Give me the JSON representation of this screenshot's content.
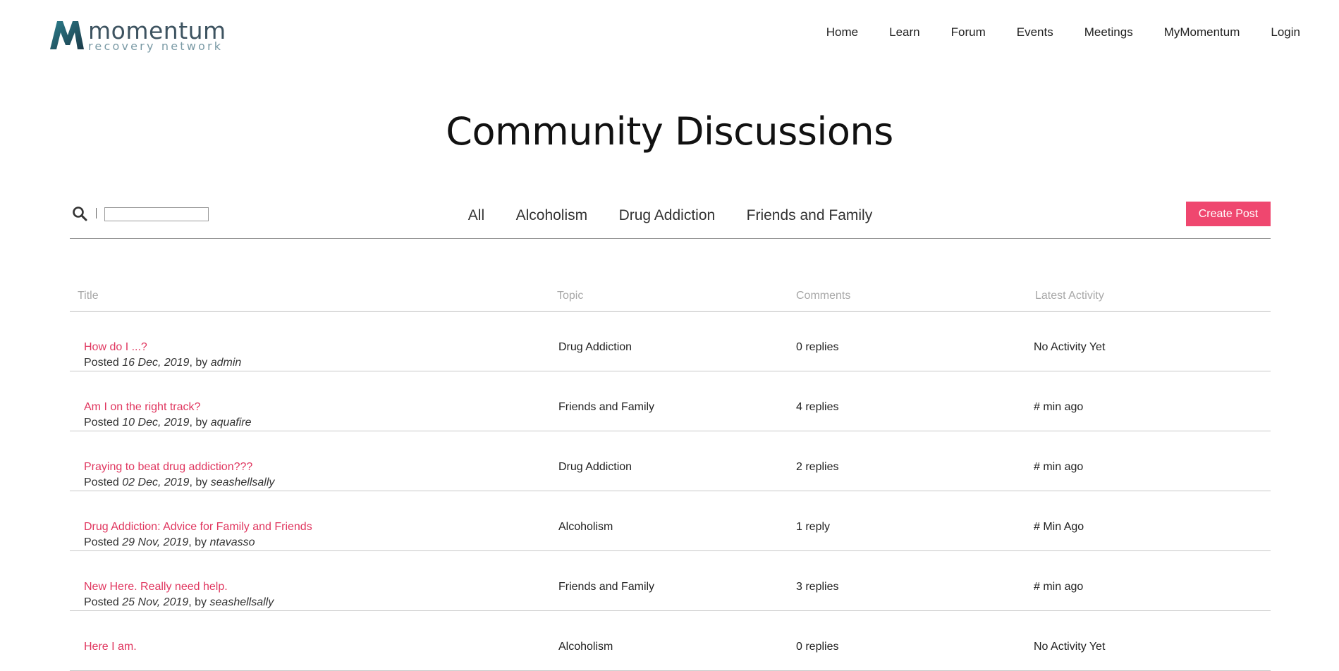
{
  "brand": {
    "name": "momentum",
    "tagline": "recovery network"
  },
  "nav": [
    "Home",
    "Learn",
    "Forum",
    "Events",
    "Meetings",
    "MyMomentum",
    "Login"
  ],
  "page_title": "Community Discussions",
  "search": {
    "placeholder": "",
    "value": ""
  },
  "filters": [
    "All",
    "Alcoholism",
    "Drug Addiction",
    "Friends and Family"
  ],
  "create_post_label": "Create Post",
  "columns": {
    "title": "Title",
    "topic": "Topic",
    "comments": "Comments",
    "activity": "Latest Activity"
  },
  "posted_label": "Posted",
  "by_label": ", by",
  "rows": [
    {
      "title": "How do I ...?",
      "date": "16 Dec, 2019",
      "author": "admin",
      "topic": "Drug Addiction",
      "comments": "0 replies",
      "activity": "No Activity Yet"
    },
    {
      "title": "Am I on the right track?",
      "date": "10 Dec, 2019",
      "author": "aquafire",
      "topic": "Friends and Family",
      "comments": "4 replies",
      "activity": "# min ago"
    },
    {
      "title": "Praying to beat drug addiction???",
      "date": "02 Dec, 2019",
      "author": "seashellsally",
      "topic": "Drug Addiction",
      "comments": "2 replies",
      "activity": "# min ago"
    },
    {
      "title": "Drug Addiction: Advice for Family and Friends",
      "date": "29 Nov, 2019",
      "author": "ntavasso",
      "topic": "Alcoholism",
      "comments": "1 reply",
      "activity": "# Min Ago"
    },
    {
      "title": "New Here. Really need help.",
      "date": "25 Nov, 2019",
      "author": "seashellsally",
      "topic": "Friends and Family",
      "comments": "3 replies",
      "activity": "# min ago"
    },
    {
      "title": "Here I am.",
      "date": "",
      "author": "",
      "topic": "Alcoholism",
      "comments": "0 replies",
      "activity": "No Activity Yet"
    }
  ],
  "colors": {
    "accent": "#ef476f",
    "link": "#e0365f",
    "logo": "#3d5360"
  }
}
